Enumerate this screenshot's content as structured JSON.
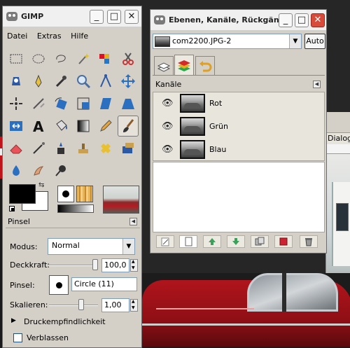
{
  "toolbox": {
    "title": "GIMP",
    "menu": [
      "Datei",
      "Extras",
      "Hilfe"
    ],
    "tool_options": {
      "title": "Pinsel",
      "mode_label": "Modus:",
      "mode_value": "Normal",
      "opacity_label": "Deckkraft:",
      "opacity_value": "100,0",
      "brush_label": "Pinsel:",
      "brush_value": "Circle (11)",
      "scale_label": "Skalieren:",
      "scale_value": "1,00",
      "pressure_label": "Druckempfindlichkeit",
      "fade_label": "Verblassen"
    }
  },
  "dialog": {
    "title": "Ebenen, Kanäle, Rückgängig",
    "image_name": "com2200.JPG-2",
    "auto_label": "Auto",
    "channels_title": "Kanäle",
    "channels": [
      {
        "name": "Rot"
      },
      {
        "name": "Grün"
      },
      {
        "name": "Blau"
      }
    ]
  },
  "background_window": {
    "label": "Dialoge"
  },
  "colors": {
    "foreground": "#000000",
    "background": "#ffffff",
    "close_button": "#d84a3a"
  }
}
